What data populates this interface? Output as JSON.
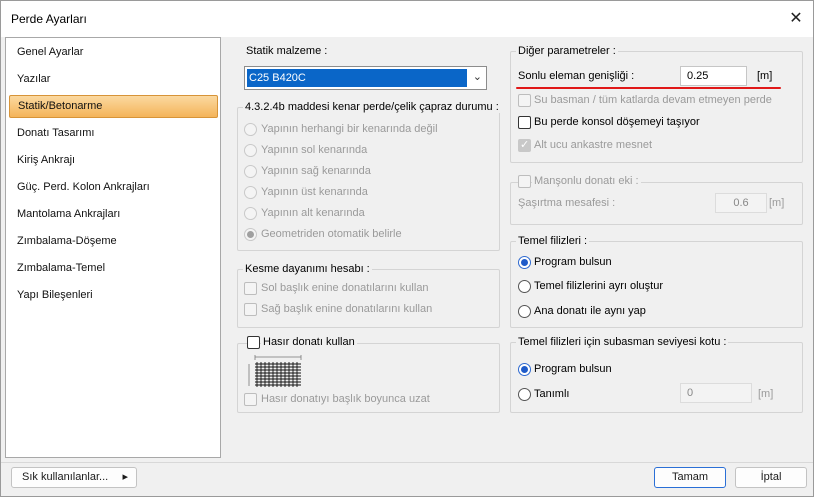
{
  "window": {
    "title": "Perde Ayarları",
    "close_glyph": "✕"
  },
  "nav": {
    "items": [
      "Genel Ayarlar",
      "Yazılar",
      "Statik/Betonarme",
      "Donatı Tasarımı",
      "Kiriş Ankrajı",
      "Güç. Perd. Kolon Ankrajları",
      "Mantolama Ankrajları",
      "Zımbalama-Döşeme",
      "Zımbalama-Temel",
      "Yapı Bileşenleri"
    ],
    "selected": "Statik/Betonarme"
  },
  "static_material": {
    "label": "Statik malzeme :",
    "value": "C25 B420C"
  },
  "corner_group": {
    "title": "4.3.2.4b maddesi kenar perde/çelik çapraz durumu :",
    "options": [
      "Yapının herhangi bir kenarında değil",
      "Yapının sol kenarında",
      "Yapının sağ kenarında",
      "Yapının üst kenarında",
      "Yapının alt kenarında",
      "Geometriden otomatik belirle"
    ],
    "selected": "Geometriden otomatik belirle"
  },
  "shear_group": {
    "title": "Kesme dayanımı hesabı :",
    "left": "Sol başlık enine donatılarını kullan",
    "right": "Sağ başlık enine donatılarını kullan"
  },
  "mesh_group": {
    "title": "Hasır donatı kullan",
    "extend": "Hasır donatıyı başlık boyunca uzat"
  },
  "other_params": {
    "title": "Diğer parametreler :",
    "fe_width_label": "Sonlu eleman genişliği :",
    "fe_width_value": "0.25",
    "fe_width_unit": "[m]",
    "opt1": "Su basman / tüm katlarda devam etmeyen perde",
    "opt2": "Bu perde konsol döşemeyi taşıyor",
    "opt3": "Alt ucu ankastre mesnet",
    "accent_color": "#e01818"
  },
  "coupler": {
    "title": "Manşonlu donatı eki :",
    "offset_label": "Şaşırtma mesafesi :",
    "offset_value": "0.6",
    "unit": "[m]"
  },
  "foundation": {
    "title": "Temel filizleri :",
    "options": [
      "Program bulsun",
      "Temel filizlerini ayrı oluştur",
      "Ana donatı ile aynı yap"
    ],
    "selected": "Program bulsun"
  },
  "basement_level": {
    "title": "Temel filizleri için subasman seviyesi kotu :",
    "opt_program": "Program bulsun",
    "opt_defined": "Tanımlı",
    "value": "0",
    "unit": "[m]",
    "selected": "Program bulsun"
  },
  "footer": {
    "frequent": "Sık kullanılanlar...",
    "ok": "Tamam",
    "cancel": "İptal"
  }
}
